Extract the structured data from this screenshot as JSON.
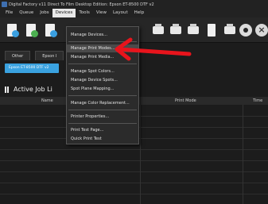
{
  "window": {
    "title": "Digital Factory v11 Direct To Film Desktop Edition: Epson ET-8500 DTF v2"
  },
  "menubar": {
    "items": [
      "File",
      "Queue",
      "Jobs",
      "Devices",
      "Tools",
      "View",
      "Layout",
      "Help"
    ],
    "active": "Devices"
  },
  "tabs": [
    "Other",
    "Epson I"
  ],
  "printer_tab": "Epson ET-8500 DTF v2",
  "section": {
    "title": "Active Job Li"
  },
  "table": {
    "columns": [
      "Name",
      "Print Mode",
      "Time"
    ]
  },
  "devices_menu": {
    "items": [
      "Manage Devices...",
      "Manage Print Modes...",
      "Manage Print Media...",
      "Manage Spot Colors...",
      "Manage Device Spots...",
      "Spot Plane Mapping...",
      "Manage Color Replacement...",
      "Printer Properties...",
      "Print Test Page...",
      "Quick Print Test"
    ],
    "highlighted": "Manage Print Modes..."
  },
  "annotation": {
    "color": "#e8141c",
    "points_to": "Manage Print Modes..."
  },
  "colors": {
    "accent": "#3aa2e0",
    "background": "#1c1c1c",
    "arrow": "#e8141c"
  },
  "icons": [
    "new-job-icon",
    "import-icon",
    "add-file-icon",
    "print-icon",
    "save-icon",
    "printer-icon",
    "device-icon",
    "settings-icon",
    "cancel-icon"
  ]
}
